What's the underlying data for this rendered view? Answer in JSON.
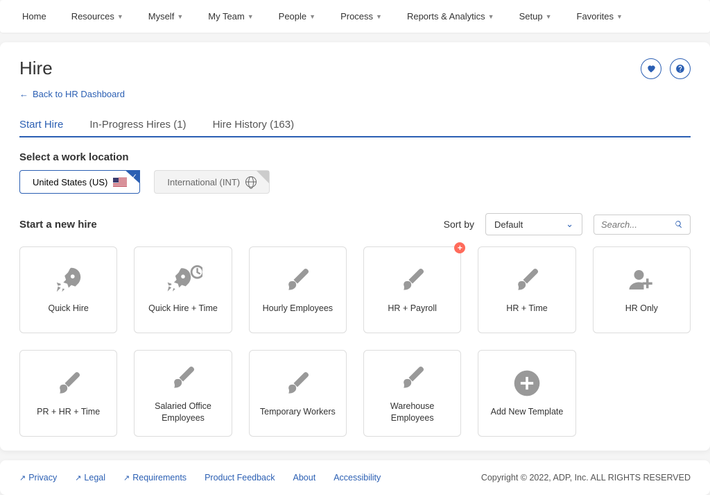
{
  "nav": [
    "Home",
    "Resources",
    "Myself",
    "My Team",
    "People",
    "Process",
    "Reports & Analytics",
    "Setup",
    "Favorites"
  ],
  "page": {
    "title": "Hire",
    "back_label": "Back to HR Dashboard"
  },
  "tabs": [
    {
      "label": "Start Hire",
      "active": true
    },
    {
      "label": "In-Progress Hires (1)",
      "active": false
    },
    {
      "label": "Hire History (163)",
      "active": false
    }
  ],
  "location": {
    "heading": "Select a work location",
    "options": [
      {
        "label": "United States (US)",
        "selected": true,
        "icon": "us-flag"
      },
      {
        "label": "International (INT)",
        "selected": false,
        "icon": "globe"
      }
    ]
  },
  "newhire": {
    "heading": "Start a new hire",
    "sort_label": "Sort by",
    "sort_value": "Default",
    "search_placeholder": "Search..."
  },
  "tiles": [
    {
      "label": "Quick Hire",
      "icon": "rocket"
    },
    {
      "label": "Quick Hire + Time",
      "icon": "rocket-clock"
    },
    {
      "label": "Hourly Employees",
      "icon": "brush"
    },
    {
      "label": "HR + Payroll",
      "icon": "brush",
      "badge": "+"
    },
    {
      "label": "HR + Time",
      "icon": "brush"
    },
    {
      "label": "HR Only",
      "icon": "person-add"
    },
    {
      "label": "PR + HR + Time",
      "icon": "brush"
    },
    {
      "label": "Salaried Office Employees",
      "icon": "brush"
    },
    {
      "label": "Temporary Workers",
      "icon": "brush"
    },
    {
      "label": "Warehouse Employees",
      "icon": "brush"
    },
    {
      "label": "Add New Template",
      "icon": "plus-circle"
    }
  ],
  "footer": {
    "links": [
      "Privacy",
      "Legal",
      "Requirements",
      "Product Feedback",
      "About",
      "Accessibility"
    ],
    "copyright": "Copyright © 2022, ADP, Inc. ALL RIGHTS RESERVED"
  }
}
